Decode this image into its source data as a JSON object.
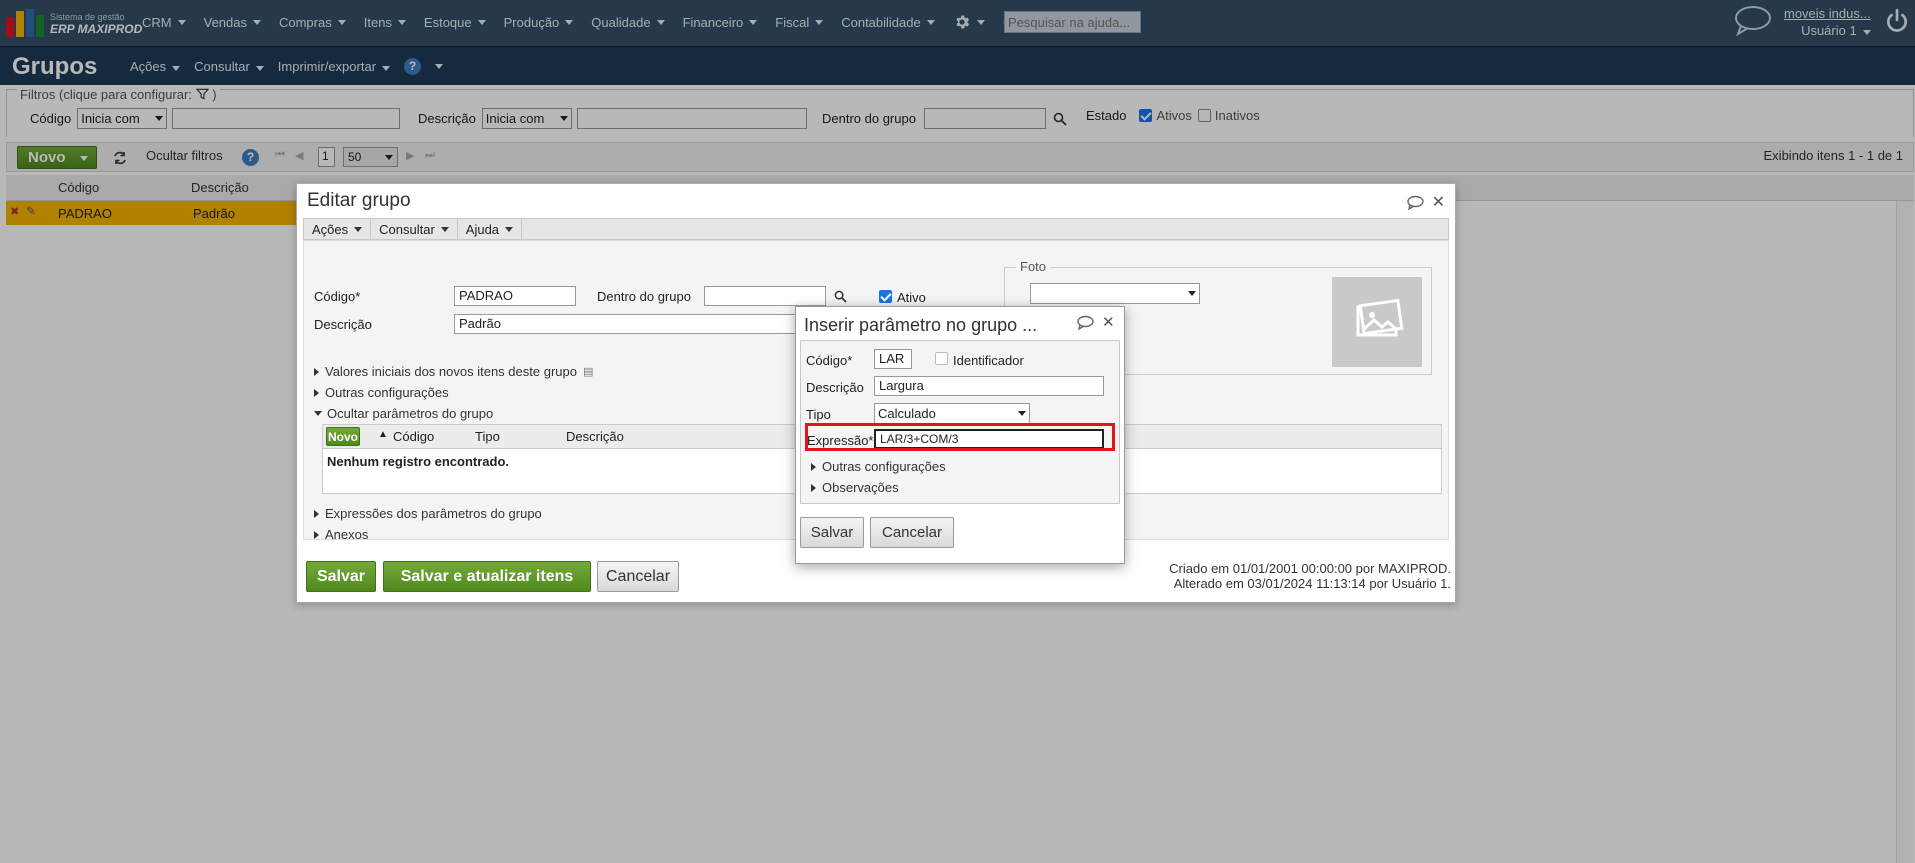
{
  "topbar": {
    "logo_small": "Sistema de gestão",
    "logo_big": "ERP MAXIPROD",
    "menu": [
      {
        "label": "CRM"
      },
      {
        "label": "Vendas"
      },
      {
        "label": "Compras"
      },
      {
        "label": "Itens"
      },
      {
        "label": "Estoque"
      },
      {
        "label": "Produção"
      },
      {
        "label": "Qualidade"
      },
      {
        "label": "Financeiro"
      },
      {
        "label": "Fiscal"
      },
      {
        "label": "Contabilidade"
      }
    ],
    "help_search_placeholder": "Pesquisar na ajuda...",
    "company": "moveis indus...",
    "user": "Usuário 1"
  },
  "titlebar": {
    "title": "Grupos",
    "menu": [
      "Ações",
      "Consultar",
      "Imprimir/exportar"
    ]
  },
  "filters": {
    "legend": "Filtros (clique para configurar:",
    "legend_close": ")",
    "codigo_label": "Código",
    "codigo_op": "Inicia com",
    "descricao_label": "Descrição",
    "descricao_op": "Inicia com",
    "dentro_label": "Dentro do grupo",
    "estado_label": "Estado",
    "ativos_label": "Ativos",
    "inativos_label": "Inativos"
  },
  "toolbar": {
    "novo": "Novo",
    "ocultar_filtros": "Ocultar filtros",
    "page": "1",
    "page_size": "50",
    "exibindo": "Exibindo itens 1 - 1 de 1"
  },
  "grid": {
    "columns": [
      "Código",
      "Descrição"
    ],
    "rows": [
      {
        "codigo": "PADRAO",
        "descricao": "Padrão"
      }
    ]
  },
  "editar_grupo": {
    "title": "Editar grupo",
    "menu": [
      "Ações",
      "Consultar",
      "Ajuda"
    ],
    "codigo_label": "Código*",
    "codigo_value": "PADRAO",
    "dentro_label": "Dentro do grupo",
    "ativo_label": "Ativo",
    "descricao_label": "Descrição",
    "descricao_value": "Padrão",
    "foto_label": "Foto",
    "sections": {
      "valores": "Valores iniciais dos novos itens deste grupo",
      "outras": "Outras configurações",
      "ocultar": "Ocultar parâmetros do grupo",
      "expressoes": "Expressões dos parâmetros do grupo",
      "anexos": "Anexos"
    },
    "param_grid": {
      "novo": "Novo",
      "columns": [
        "Código",
        "Tipo",
        "Descrição"
      ],
      "empty": "Nenhum registro encontrado."
    },
    "salvar": "Salvar",
    "salvar_atualizar": "Salvar e atualizar itens",
    "cancelar": "Cancelar",
    "criado": "Criado em 01/01/2001 00:00:00 por MAXIPROD.",
    "alterado": "Alterado em 03/01/2024 11:13:14 por Usuário 1."
  },
  "inserir_parametro": {
    "title": "Inserir parâmetro no grupo ...",
    "codigo_label": "Código*",
    "codigo_value": "LAR",
    "identificador_label": "Identificador",
    "descricao_label": "Descrição",
    "descricao_value": "Largura",
    "tipo_label": "Tipo",
    "tipo_value": "Calculado",
    "expressao_label": "Expressão*",
    "expressao_value": "LAR/3+COM/3",
    "outras": "Outras configurações",
    "observacoes": "Observações",
    "salvar": "Salvar",
    "cancelar": "Cancelar"
  },
  "colors": {
    "topbar": "#344f68",
    "titlebar": "#1f3b58",
    "green": "#5a9a22",
    "selected_row": "#f4b400",
    "highlight": "#e0161e"
  }
}
